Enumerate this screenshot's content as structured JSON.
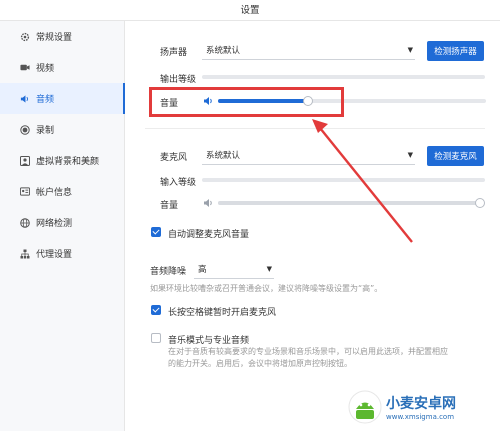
{
  "window": {
    "title": "设置"
  },
  "sidebar": {
    "items": [
      {
        "label": "常规设置",
        "icon": "gear-icon",
        "active": false
      },
      {
        "label": "视频",
        "icon": "video-camera-icon",
        "active": false
      },
      {
        "label": "音频",
        "icon": "speaker-icon",
        "active": true
      },
      {
        "label": "录制",
        "icon": "record-icon",
        "active": false
      },
      {
        "label": "虚拟背景和美颜",
        "icon": "portrait-icon",
        "active": false
      },
      {
        "label": "帐户信息",
        "icon": "account-card-icon",
        "active": false
      },
      {
        "label": "网络检测",
        "icon": "globe-icon",
        "active": false
      },
      {
        "label": "代理设置",
        "icon": "network-tree-icon",
        "active": false
      }
    ]
  },
  "speaker": {
    "label": "扬声器",
    "device": "系统默认",
    "test_button": "检测扬声器",
    "output_level_label": "输出等级",
    "volume_label": "音量",
    "volume": 0.75
  },
  "mic": {
    "label": "麦克风",
    "device": "系统默认",
    "test_button": "检测麦克风",
    "input_level_label": "输入等级",
    "volume_label": "音量",
    "volume": 1.0,
    "auto_adjust_label": "自动调整麦克风音量",
    "auto_adjust_checked": true
  },
  "noise": {
    "label": "音频降噪",
    "value": "高",
    "hint": "如果环境比较嘈杂或召开普通会议，建议将降噪等级设置为“高”。"
  },
  "hold_space": {
    "label": "长按空格键暂时开启麦克风",
    "checked": true
  },
  "music_mode": {
    "label": "音乐模式与专业音频",
    "checked": false,
    "hint": "在对于音质有较高要求的专业场景和音乐场景中，可以启用此选项，并配置相应的能力开关。启用后，会议中将增加原声控制按钮。"
  },
  "watermark": {
    "text": "小麦安卓网",
    "url": "www.xmsigma.com"
  },
  "colors": {
    "accent": "#1f6bd6",
    "highlight": "#e23b3b"
  }
}
